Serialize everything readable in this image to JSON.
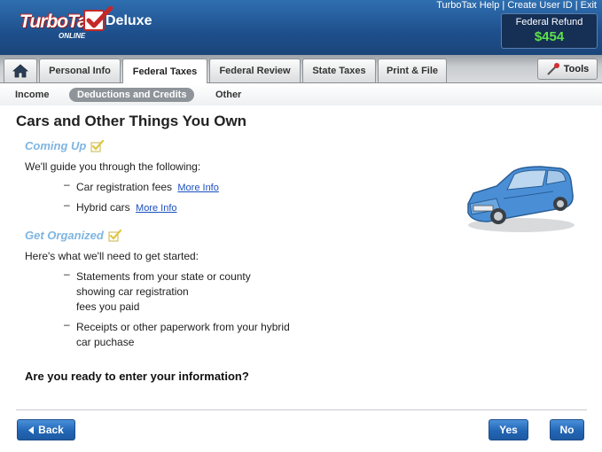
{
  "header": {
    "logo_text": "TurboTax",
    "logo_subtext": "ONLINE",
    "product": "Deluxe",
    "links": [
      "TurboTax Help",
      "Create User ID",
      "Exit"
    ],
    "link_separator": "|",
    "refund_label": "Federal Refund",
    "refund_amount": "$454"
  },
  "tabs": [
    {
      "label": "Personal Info"
    },
    {
      "label": "Federal Taxes"
    },
    {
      "label": "Federal Review"
    },
    {
      "label": "State Taxes"
    },
    {
      "label": "Print & File"
    }
  ],
  "tools_label": "Tools",
  "subnav": [
    "Income",
    "Deductions and Credits",
    "Other"
  ],
  "main": {
    "title": "Cars and Other Things You Own",
    "coming_up": {
      "heading": "Coming Up",
      "intro": "We'll guide you through the following:",
      "items": [
        {
          "text": "Car registration fees",
          "link": "More Info"
        },
        {
          "text": "Hybrid cars",
          "link": "More Info"
        }
      ]
    },
    "get_organized": {
      "heading": "Get Organized",
      "intro": "Here's what we'll need to get started:",
      "items": [
        {
          "lines": [
            "Statements from your state or county",
            "showing car registration",
            "fees you paid"
          ]
        },
        {
          "lines": [
            "Receipts or other paperwork from your hybrid",
            "car puchase"
          ]
        }
      ]
    },
    "question": "Are you ready to enter your information?"
  },
  "buttons": {
    "back": "Back",
    "yes": "Yes",
    "no": "No"
  },
  "colors": {
    "header_blue": "#1e4f8c",
    "refund_green": "#5ee04a",
    "section_heading": "#7fb5e0",
    "button_blue": "#2366b5",
    "link_blue": "#1a4fc0"
  }
}
